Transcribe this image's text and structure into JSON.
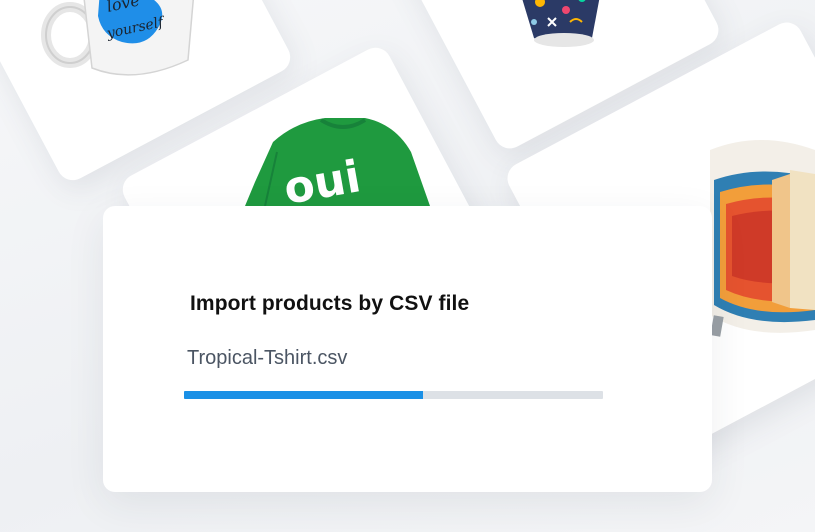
{
  "import_dialog": {
    "title": "Import products by CSV file",
    "file_name": "Tropical-Tshirt.csv",
    "progress_fraction": 0.57
  },
  "products": {
    "mug": {
      "print_text": "love yourself",
      "icon": "mug-icon"
    },
    "patterned_cup": {
      "icon": "cup-icon"
    },
    "sweatshirt": {
      "print_text": "oui",
      "icon": "sweatshirt-icon"
    },
    "pillow": {
      "icon": "pillow-icon"
    }
  },
  "colors": {
    "progress_fill": "#1a90e6",
    "progress_track": "#dde1e6",
    "sweatshirt_green": "#1f9a3f",
    "mug_blue": "#1f8ee8"
  }
}
